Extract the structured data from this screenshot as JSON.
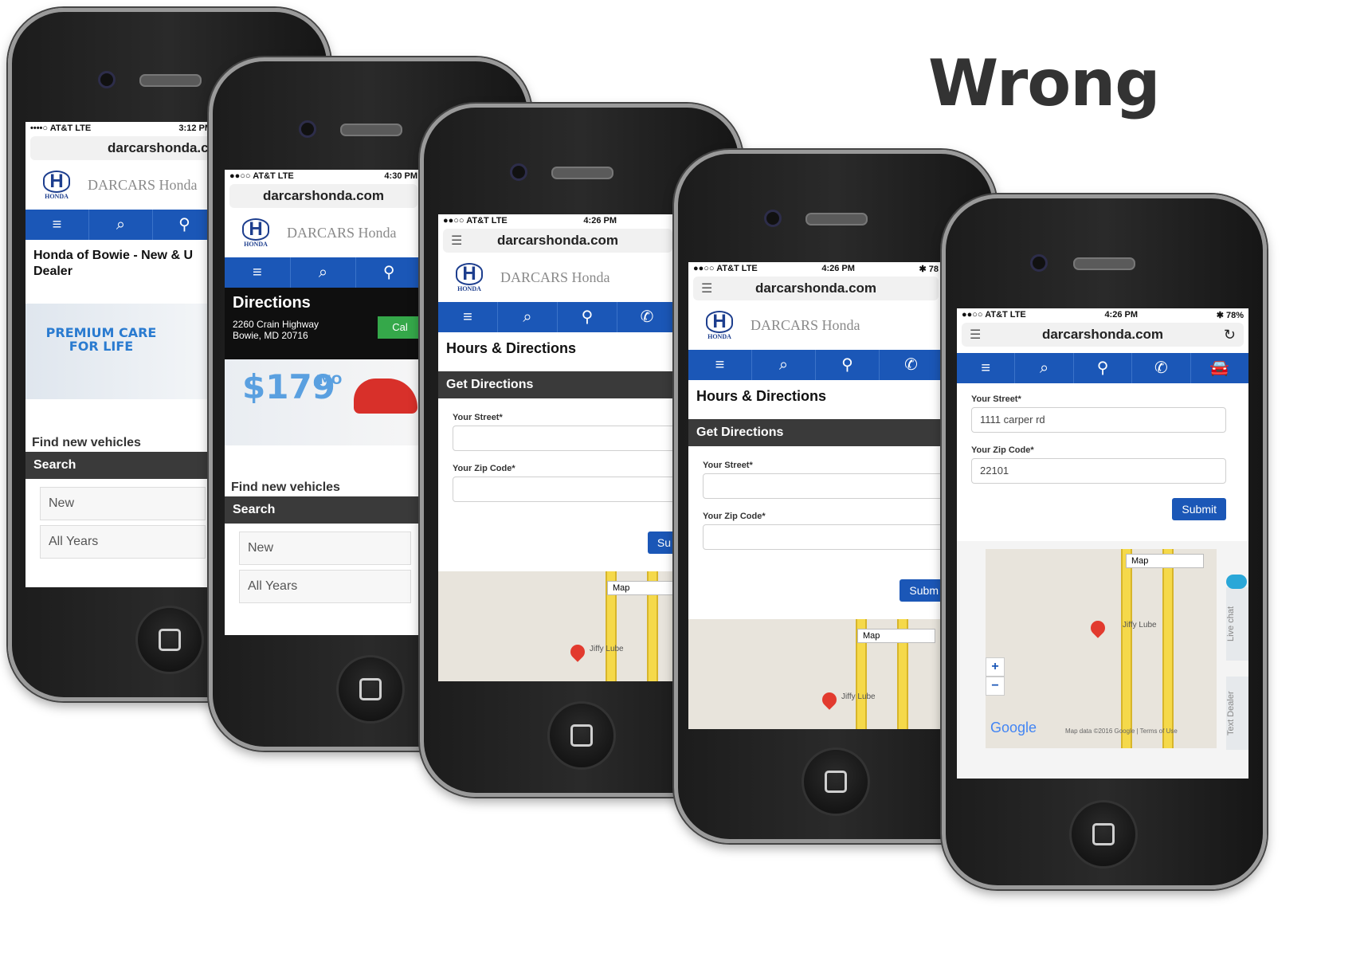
{
  "headline": "Wrong",
  "phones": [
    {
      "status_left": "••••○ AT&T  LTE",
      "status_time": "3:12 PM",
      "url": "darcarshonda.co",
      "logo_h": "H",
      "logo_text": "HONDA",
      "dealer": "DARCARS Honda",
      "nav_icons": [
        "≡",
        "⌕",
        "⚲"
      ],
      "page_title": "Honda of Bowie - New & U Dealer",
      "promo_text": "PREMIUM CARE FOR LIFE",
      "section_label": "Find new vehicles",
      "bar_label": "Search",
      "select1": "New",
      "select2": "All Years"
    },
    {
      "status_left": "●●○○ AT&T  LTE",
      "status_time": "4:30 PM",
      "url": "darcarshonda.com",
      "logo_h": "H",
      "logo_text": "HONDA",
      "dealer": "DARCARS Honda",
      "nav_icons": [
        "≡",
        "⌕",
        "⚲"
      ],
      "banner_title": "Directions",
      "address1": "2260 Crain Highway",
      "address2": "Bowie, MD 20716",
      "call_label": "Cal",
      "price": "$179",
      "price_suffix": "/MO",
      "section_label": "Find new vehicles",
      "bar_label": "Search",
      "select1": "New",
      "select2": "All Years"
    },
    {
      "status_left": "●●○○ AT&T  LTE",
      "status_time": "4:26 PM",
      "url": "darcarshonda.com",
      "logo_h": "H",
      "logo_text": "HONDA",
      "dealer": "DARCARS Honda",
      "nav_icons": [
        "≡",
        "⌕",
        "⚲",
        "✆"
      ],
      "page_title": "Hours & Directions",
      "bar_label": "Get Directions",
      "street_label": "Your Street*",
      "zip_label": "Your Zip Code*",
      "submit": "Su",
      "map_select": "Map",
      "map_place": "Jiffy Lube"
    },
    {
      "status_left": "●●○○ AT&T  LTE",
      "status_time": "4:26 PM",
      "status_right": "✱ 78",
      "url": "darcarshonda.com",
      "logo_h": "H",
      "logo_text": "HONDA",
      "dealer": "DARCARS Honda",
      "nav_icons": [
        "≡",
        "⌕",
        "⚲",
        "✆"
      ],
      "page_title": "Hours & Directions",
      "bar_label": "Get Directions",
      "street_label": "Your Street*",
      "zip_label": "Your Zip Code*",
      "submit": "Subm",
      "map_select": "Map",
      "map_place": "Jiffy Lube"
    },
    {
      "status_left": "●●○○ AT&T  LTE",
      "status_time": "4:26 PM",
      "status_right": "✱ 78%",
      "url": "darcarshonda.com",
      "nav_icons": [
        "≡",
        "⌕",
        "⚲",
        "✆",
        "🚘"
      ],
      "street_label": "Your Street*",
      "street_value": "1111 carper rd",
      "zip_label": "Your Zip Code*",
      "zip_value": "22101",
      "submit": "Submit",
      "map_select": "Map",
      "map_place": "Jiffy Lube",
      "zoom_in": "+",
      "zoom_out": "−",
      "google": "Google",
      "map_credit": "Map data ©2016 Google | Terms of Use",
      "live_chat": "Live chat",
      "text_dealer": "Text Dealer"
    }
  ]
}
